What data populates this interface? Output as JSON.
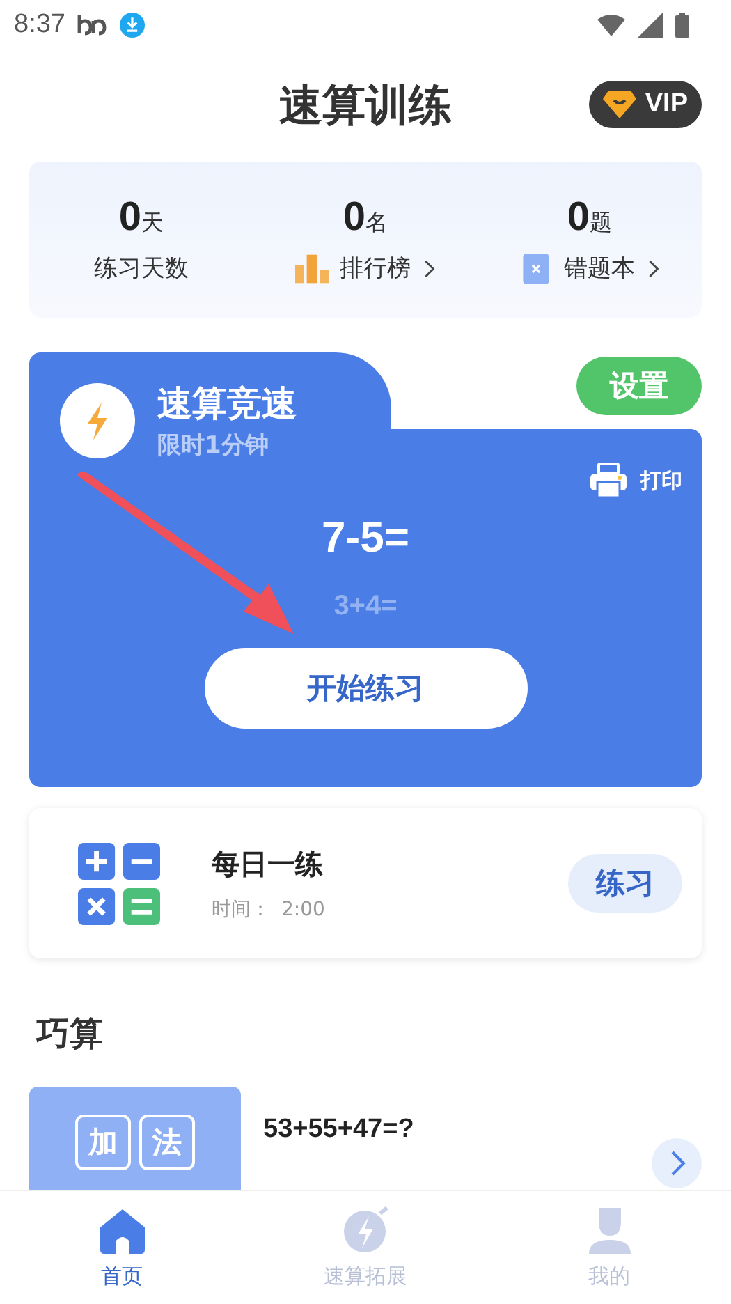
{
  "status_bar": {
    "time": "8:37"
  },
  "header": {
    "title": "速算训练",
    "vip": "VIP"
  },
  "stats": [
    {
      "value": "0",
      "unit": "天",
      "label": "练习天数",
      "kind": "plain"
    },
    {
      "value": "0",
      "unit": "名",
      "label": "排行榜",
      "kind": "ranking"
    },
    {
      "value": "0",
      "unit": "题",
      "label": "错题本",
      "kind": "mistakes"
    }
  ],
  "speed_card": {
    "title": "速算竞速",
    "subtitle": "限时1分钟",
    "settings": "设置",
    "print": "打印",
    "question": "7-5=",
    "next_question": "3+4=",
    "start": "开始练习"
  },
  "daily": {
    "title": "每日一练",
    "time_label": "时间：",
    "time": "2:00",
    "button": "练习"
  },
  "section_title": "巧算",
  "tricks": [
    {
      "tag_1": "加",
      "tag_2": "法",
      "question": "53+55+47=?"
    }
  ],
  "bottom_nav": [
    {
      "label": "首页",
      "kind": "home",
      "selected": true
    },
    {
      "label": "速算拓展",
      "kind": "bolt",
      "selected": false
    },
    {
      "label": "我的",
      "kind": "person",
      "selected": false
    }
  ]
}
